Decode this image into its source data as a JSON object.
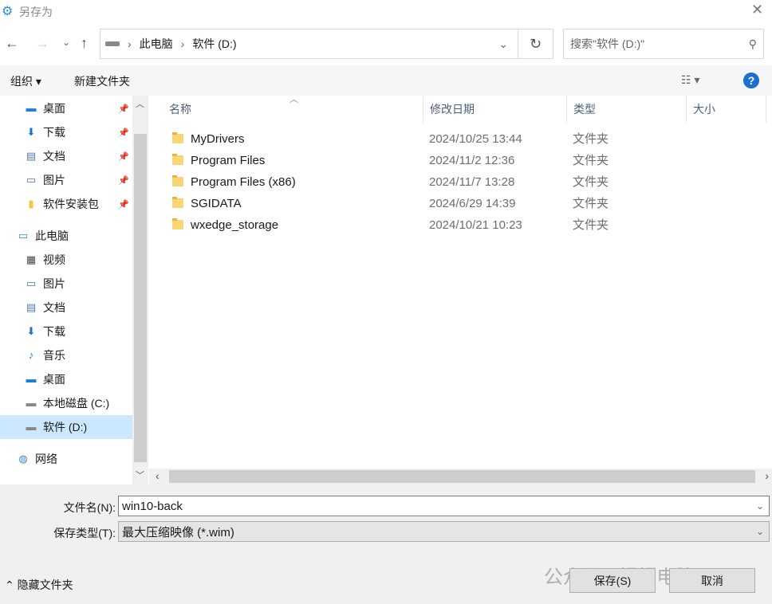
{
  "title": "另存为",
  "breadcrumb": [
    "此电脑",
    "软件 (D:)"
  ],
  "search_placeholder": "搜索\"软件 (D:)\"",
  "toolbar": {
    "organize": "组织",
    "new_folder": "新建文件夹"
  },
  "sidebar": [
    {
      "label": "桌面",
      "icon": "desktop-icon",
      "pinned": true
    },
    {
      "label": "下载",
      "icon": "download-icon",
      "pinned": true
    },
    {
      "label": "文档",
      "icon": "document-icon",
      "pinned": true
    },
    {
      "label": "图片",
      "icon": "picture-icon",
      "pinned": true
    },
    {
      "label": "软件安装包",
      "icon": "folder-icon",
      "pinned": true
    },
    {
      "label": "此电脑",
      "icon": "computer-icon",
      "pinned": false
    },
    {
      "label": "视频",
      "icon": "video-icon",
      "pinned": false
    },
    {
      "label": "图片",
      "icon": "picture-icon",
      "pinned": false
    },
    {
      "label": "文档",
      "icon": "document-icon",
      "pinned": false
    },
    {
      "label": "下载",
      "icon": "download-icon",
      "pinned": false
    },
    {
      "label": "音乐",
      "icon": "music-icon",
      "pinned": false
    },
    {
      "label": "桌面",
      "icon": "desktop-icon",
      "pinned": false
    },
    {
      "label": "本地磁盘 (C:)",
      "icon": "drive-icon",
      "pinned": false
    },
    {
      "label": "软件 (D:)",
      "icon": "drive-icon",
      "pinned": false,
      "selected": true
    },
    {
      "label": "网络",
      "icon": "network-icon",
      "pinned": false
    }
  ],
  "columns": [
    "名称",
    "修改日期",
    "类型",
    "大小"
  ],
  "files": [
    {
      "name": "MyDrivers",
      "date": "2024/10/25 13:44",
      "type": "文件夹"
    },
    {
      "name": "Program Files",
      "date": "2024/11/2 12:36",
      "type": "文件夹"
    },
    {
      "name": "Program Files (x86)",
      "date": "2024/11/7 13:28",
      "type": "文件夹"
    },
    {
      "name": "SGIDATA",
      "date": "2024/6/29 14:39",
      "type": "文件夹"
    },
    {
      "name": "wxedge_storage",
      "date": "2024/10/21 10:23",
      "type": "文件夹"
    }
  ],
  "filename_label": "文件名(N):",
  "filename_value": "win10-back",
  "filetype_label": "保存类型(T):",
  "filetype_value": "最大压缩映像 (*.wim)",
  "hide_folders": "隐藏文件夹",
  "save": "保存(S)",
  "cancel": "取消",
  "watermark": "公众号 · 帽帽电脑"
}
